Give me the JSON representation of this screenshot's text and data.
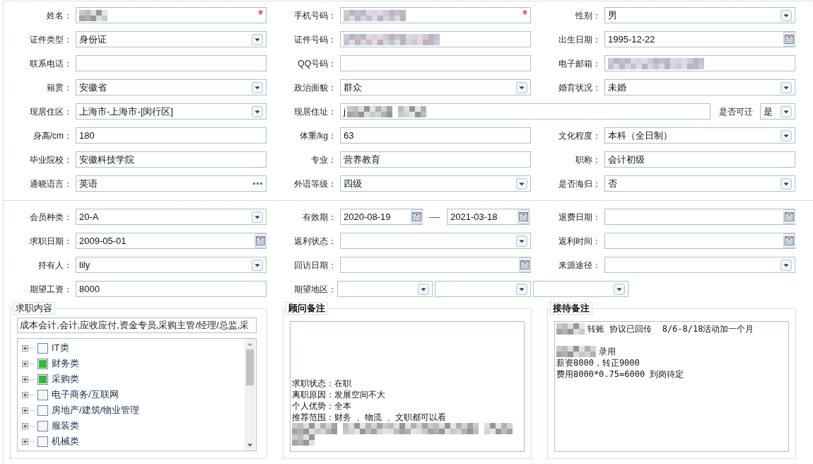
{
  "basic_info": {
    "rows": [
      {
        "fields": [
          {
            "kind": "text",
            "label": "姓名：",
            "required": true,
            "redacted": true
          },
          {
            "kind": "text",
            "label": "手机号码：",
            "required": true,
            "redacted": true
          },
          {
            "kind": "select",
            "label": "性别：",
            "value": "男"
          }
        ]
      },
      {
        "fields": [
          {
            "kind": "select",
            "label": "证件类型：",
            "value": "身份证"
          },
          {
            "kind": "text",
            "label": "证件号码：",
            "redacted": true
          },
          {
            "kind": "date",
            "label": "出生日期：",
            "value": "1995-12-22"
          }
        ]
      },
      {
        "fields": [
          {
            "kind": "text",
            "label": "联系电话："
          },
          {
            "kind": "text",
            "label": "QQ号码："
          },
          {
            "kind": "text",
            "label": "电子邮箱：",
            "redacted": true
          }
        ]
      },
      {
        "fields": [
          {
            "kind": "select",
            "label": "籍贯：",
            "value": "安徽省"
          },
          {
            "kind": "select",
            "label": "政治面貌：",
            "value": "群众"
          },
          {
            "kind": "select",
            "label": "婚育状况：",
            "value": "未婚"
          }
        ]
      },
      {
        "fields": [
          {
            "kind": "select",
            "label": "现居住区：",
            "value": "上海市-上海市-[闵行区]"
          },
          {
            "kind": "text",
            "label": "现居住址：",
            "value": "j",
            "redacted": true
          },
          {
            "kind": "inline_select",
            "label": "是否可迁",
            "value": "是"
          }
        ]
      },
      {
        "fields": [
          {
            "kind": "text",
            "label": "身高/cm：",
            "value": "180"
          },
          {
            "kind": "text",
            "label": "体重/kg：",
            "value": "63"
          },
          {
            "kind": "select",
            "label": "文化程度：",
            "value": "本科（全日制）"
          }
        ]
      },
      {
        "fields": [
          {
            "kind": "text",
            "label": "毕业院校：",
            "value": "安徽科技学院"
          },
          {
            "kind": "text",
            "label": "专业：",
            "value": "营养教育"
          },
          {
            "kind": "text",
            "label": "职称：",
            "value": "会计初级"
          }
        ]
      },
      {
        "fields": [
          {
            "kind": "picker",
            "label": "通晓语言：",
            "value": "英语"
          },
          {
            "kind": "select",
            "label": "外语等级：",
            "value": "四级"
          },
          {
            "kind": "select",
            "label": "是否海归：",
            "value": "否"
          }
        ]
      }
    ]
  },
  "membership": {
    "rows": [
      {
        "fields": [
          {
            "kind": "select",
            "label": "会员种类：",
            "value": "20-A"
          },
          {
            "kind": "date_range",
            "label": "有效期：",
            "from": "2020-08-19",
            "separator": "----",
            "to": "2021-03-18"
          },
          {
            "kind": "date",
            "label": "退费日期："
          }
        ]
      },
      {
        "fields": [
          {
            "kind": "date",
            "label": "求职日期：",
            "value": "2009-05-01"
          },
          {
            "kind": "select",
            "label": "返利状态："
          },
          {
            "kind": "date",
            "label": "返利时间："
          }
        ]
      },
      {
        "fields": [
          {
            "kind": "select",
            "label": "持有人：",
            "value": "lily"
          },
          {
            "kind": "date",
            "label": "回访日期："
          },
          {
            "kind": "select",
            "label": "来源途径："
          }
        ]
      },
      {
        "fields": [
          {
            "kind": "text",
            "label": "期望工资：",
            "value": "8000"
          },
          {
            "kind": "select_group",
            "label": "期望地区：",
            "selects": [
              {
                "kind": "select"
              },
              {
                "kind": "select"
              },
              {
                "kind": "select"
              }
            ]
          }
        ]
      }
    ]
  },
  "job_content": {
    "legend": "求职内容",
    "summary": "成本会计,会计,应收应付,资金专员,采购主管/经理/总监,采",
    "tree": [
      {
        "label": "IT类",
        "expanded": false,
        "checked": false
      },
      {
        "label": "财务类",
        "expanded": false,
        "checked": true
      },
      {
        "label": "采购类",
        "expanded": false,
        "checked": true
      },
      {
        "label": "电子商务/互联网",
        "expanded": false,
        "checked": false
      },
      {
        "label": "房地产/建筑/物业管理",
        "expanded": false,
        "checked": false
      },
      {
        "label": "服装类",
        "expanded": false,
        "checked": false
      },
      {
        "label": "机械类",
        "expanded": false,
        "checked": false
      }
    ]
  },
  "advisor_notes": {
    "legend": "顾问备注",
    "lines": [
      {
        "kind": "text",
        "text": "求职状态：在职"
      },
      {
        "kind": "text",
        "text": "离职原因：发展空间不大"
      },
      {
        "kind": "text",
        "text": "个人优势：全本"
      },
      {
        "kind": "text",
        "text": "推荐范围：财务 、物流 、文职都可以看"
      },
      {
        "kind": "redacted"
      },
      {
        "kind": "redacted"
      }
    ]
  },
  "reception_notes": {
    "legend": "接待备注",
    "lines": [
      {
        "kind": "text",
        "redacted_prefix": true,
        "text": "转账 协议已回传  8/6-8/18活动加一个月"
      },
      {
        "kind": "blank"
      },
      {
        "kind": "text",
        "redacted_prefix": true,
        "text": "录用"
      },
      {
        "kind": "text",
        "redacted_prefix": false,
        "text": "薪资8000，转正9000"
      },
      {
        "kind": "text",
        "redacted_prefix": false,
        "text": "费用8000*0.75=6000 到岗待定"
      }
    ]
  }
}
